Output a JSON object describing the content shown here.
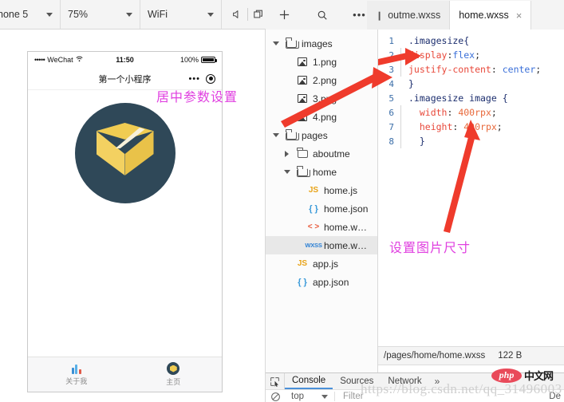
{
  "toolbar": {
    "device": "hone 5",
    "zoom": "75%",
    "network": "WiFi",
    "mute_icon": "speaker-mute-icon",
    "window_icon": "detach-window-icon"
  },
  "explorer_head": {
    "add": "+",
    "search_icon": "search-icon",
    "more": "•••"
  },
  "tabs": [
    {
      "label": "outme.wxss",
      "active": false,
      "closable": false
    },
    {
      "label": "home.wxss",
      "active": true,
      "closable": true,
      "close": "×"
    }
  ],
  "simulator": {
    "status": {
      "signal": "•••••",
      "carrier": "WeChat",
      "wifi_icon": "wifi-icon",
      "time": "11:50",
      "battery_pct": "100%"
    },
    "nav": {
      "title": "第一个小程序",
      "more_icon": "more-dots-icon",
      "target_icon": "target-circle-icon"
    },
    "content": {
      "image_icon": "package-box-image"
    },
    "tabbar": [
      {
        "label": "关于我",
        "icon": "chart-bars-icon",
        "active": false
      },
      {
        "label": "主页",
        "icon": "package-box-icon",
        "active": true
      }
    ]
  },
  "tree": [
    {
      "depth": 1,
      "arrow": "down",
      "icon": "folder-open-icon",
      "name": "images",
      "selected": false
    },
    {
      "depth": 2,
      "arrow": "none",
      "icon": "image-file-icon",
      "name": "1.png",
      "selected": false
    },
    {
      "depth": 2,
      "arrow": "none",
      "icon": "image-file-icon",
      "name": "2.png",
      "selected": false
    },
    {
      "depth": 2,
      "arrow": "none",
      "icon": "image-file-icon",
      "name": "3.png",
      "selected": false
    },
    {
      "depth": 2,
      "arrow": "none",
      "icon": "image-file-icon",
      "name": "4.png",
      "selected": false
    },
    {
      "depth": 1,
      "arrow": "down",
      "icon": "folder-open-icon",
      "name": "pages",
      "selected": false
    },
    {
      "depth": 2,
      "arrow": "right",
      "icon": "folder-closed-icon",
      "name": "aboutme",
      "selected": false
    },
    {
      "depth": 2,
      "arrow": "down",
      "icon": "folder-open-icon",
      "name": "home",
      "selected": false
    },
    {
      "depth": 3,
      "arrow": "none",
      "icon": "js-file-icon",
      "name": "home.js",
      "selected": false
    },
    {
      "depth": 3,
      "arrow": "none",
      "icon": "json-file-icon",
      "name": "home.json",
      "selected": false
    },
    {
      "depth": 3,
      "arrow": "none",
      "icon": "wxml-file-icon",
      "name": "home.w…",
      "selected": false
    },
    {
      "depth": 3,
      "arrow": "none",
      "icon": "wxss-file-icon",
      "name": "home.w…",
      "selected": true
    },
    {
      "depth": 2,
      "arrow": "none",
      "icon": "js-file-icon",
      "name": "app.js",
      "selected": false
    },
    {
      "depth": 2,
      "arrow": "none",
      "icon": "json-file-icon",
      "name": "app.json",
      "selected": false
    }
  ],
  "code": {
    "lines": [
      {
        "no": "1",
        "gutter": false,
        "tokens": [
          {
            "t": ".imagesize",
            "c": "c-sel"
          },
          {
            "t": "{",
            "c": "c-brace"
          }
        ]
      },
      {
        "no": "2",
        "gutter": true,
        "tokens": [
          {
            "t": "display",
            "c": "c-prop"
          },
          {
            "t": ":",
            "c": "c-pun"
          },
          {
            "t": "flex",
            "c": "c-val"
          },
          {
            "t": ";",
            "c": "c-pun"
          }
        ]
      },
      {
        "no": "3",
        "gutter": true,
        "tokens": [
          {
            "t": "justify-content",
            "c": "c-prop"
          },
          {
            "t": ": ",
            "c": "c-pun"
          },
          {
            "t": "center",
            "c": "c-val"
          },
          {
            "t": ";",
            "c": "c-pun"
          }
        ]
      },
      {
        "no": "4",
        "gutter": false,
        "tokens": [
          {
            "t": "}",
            "c": "c-brace"
          }
        ]
      },
      {
        "no": "5",
        "gutter": false,
        "tokens": [
          {
            "t": ".imagesize image",
            "c": "c-sel"
          },
          {
            "t": " {",
            "c": "c-brace"
          }
        ]
      },
      {
        "no": "6",
        "gutter": true,
        "tokens": [
          {
            "t": "  width",
            "c": "c-prop"
          },
          {
            "t": ": ",
            "c": "c-pun"
          },
          {
            "t": "400rpx",
            "c": "c-num"
          },
          {
            "t": ";",
            "c": "c-pun"
          }
        ]
      },
      {
        "no": "7",
        "gutter": true,
        "tokens": [
          {
            "t": "  height",
            "c": "c-prop"
          },
          {
            "t": ": ",
            "c": "c-pun"
          },
          {
            "t": "400rpx",
            "c": "c-num"
          },
          {
            "t": ";",
            "c": "c-pun"
          }
        ]
      },
      {
        "no": "8",
        "gutter": true,
        "tokens": [
          {
            "t": "  }",
            "c": "c-brace"
          }
        ]
      }
    ]
  },
  "statusbar": {
    "path": "/pages/home/home.wxss",
    "size": "122 B"
  },
  "devtools": {
    "inspect_icon": "inspect-element-icon",
    "tabs": [
      {
        "label": "Console",
        "active": true
      },
      {
        "label": "Sources",
        "active": false
      },
      {
        "label": "Network",
        "active": false
      }
    ],
    "more": "»",
    "clear_icon": "clear-console-icon",
    "context": "top",
    "filter_placeholder": "Filter",
    "default_levels": "De"
  },
  "annotations": [
    {
      "text": "居中参数设置",
      "color": "#e040e0"
    },
    {
      "text": "设置图片尺寸",
      "color": "#e040e0"
    }
  ],
  "watermark": {
    "php_text": "php",
    "php_cn": "中文网",
    "url": "https://blog.csdn.net/qq_31496003"
  }
}
